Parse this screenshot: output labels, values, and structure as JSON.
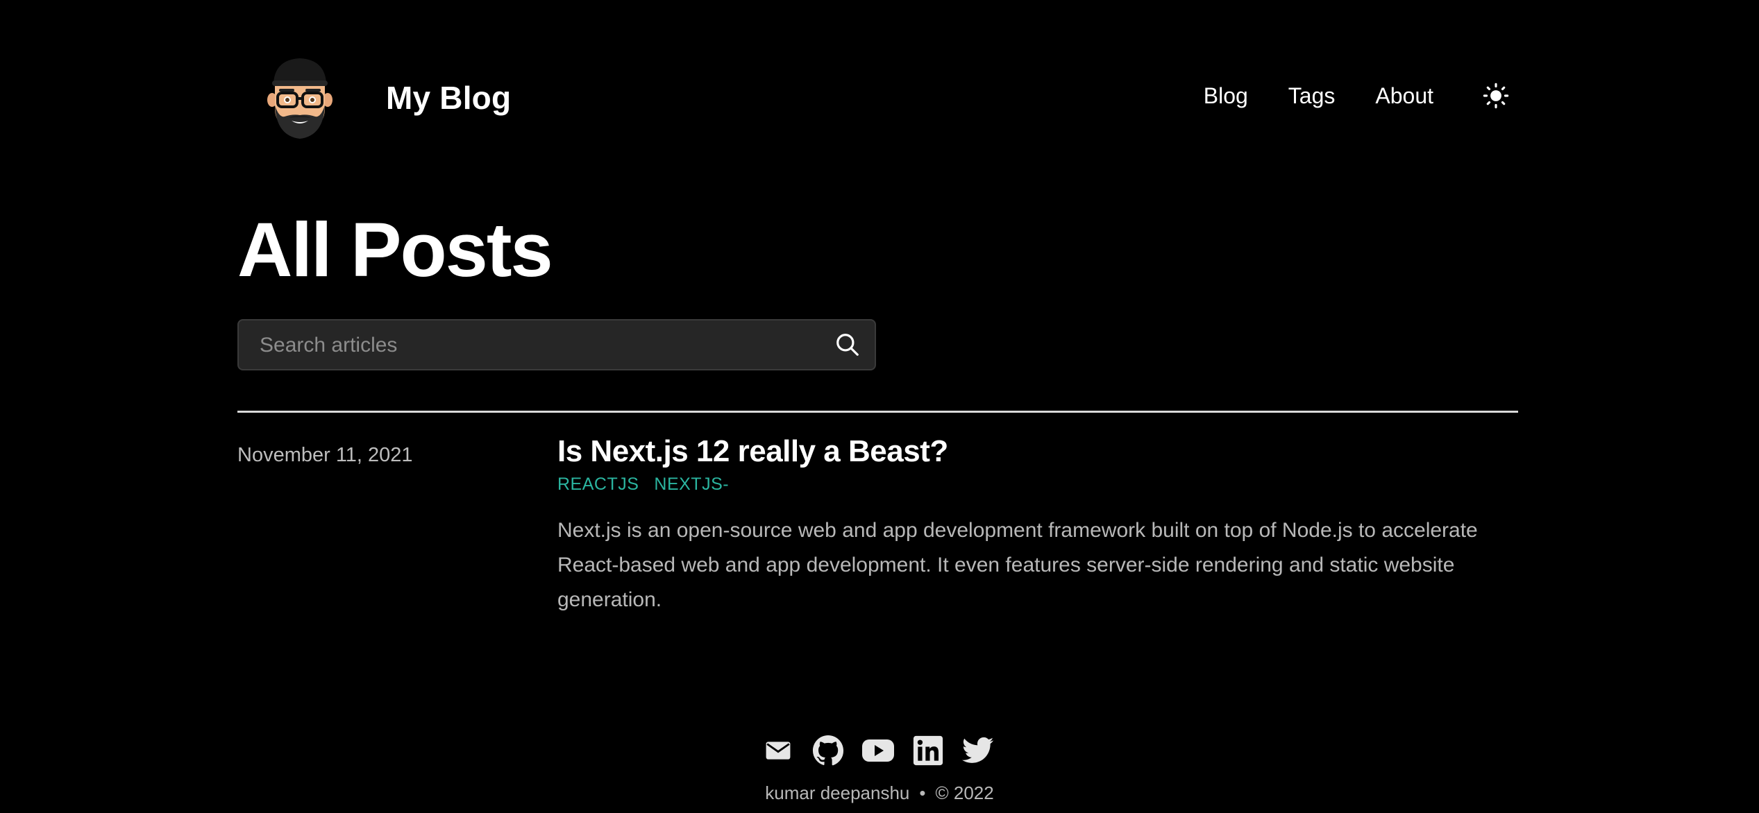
{
  "header": {
    "site_title": "My Blog",
    "nav": [
      {
        "label": "Blog"
      },
      {
        "label": "Tags"
      },
      {
        "label": "About"
      }
    ],
    "theme_toggle_icon": "sun-icon"
  },
  "main": {
    "page_title": "All Posts",
    "search": {
      "placeholder": "Search articles",
      "value": "",
      "icon": "search-icon"
    },
    "posts": [
      {
        "date": "November 11, 2021",
        "title": "Is Next.js 12 really a Beast?",
        "tags": [
          "REACTJS",
          "NEXTJS-"
        ],
        "summary": "Next.js is an open-source web and app development framework built on top of Node.js to accelerate React-based web and app development. It even features server-side rendering and static website generation."
      }
    ]
  },
  "footer": {
    "social_icons": [
      "mail-icon",
      "github-icon",
      "youtube-icon",
      "linkedin-icon",
      "twitter-icon"
    ],
    "author": "kumar deepanshu",
    "separator": "•",
    "copyright": "© 2022"
  },
  "colors": {
    "background": "#000000",
    "tag_accent": "#2bb5a0",
    "search_bg": "#262626",
    "muted_text": "#b8b8b8"
  }
}
